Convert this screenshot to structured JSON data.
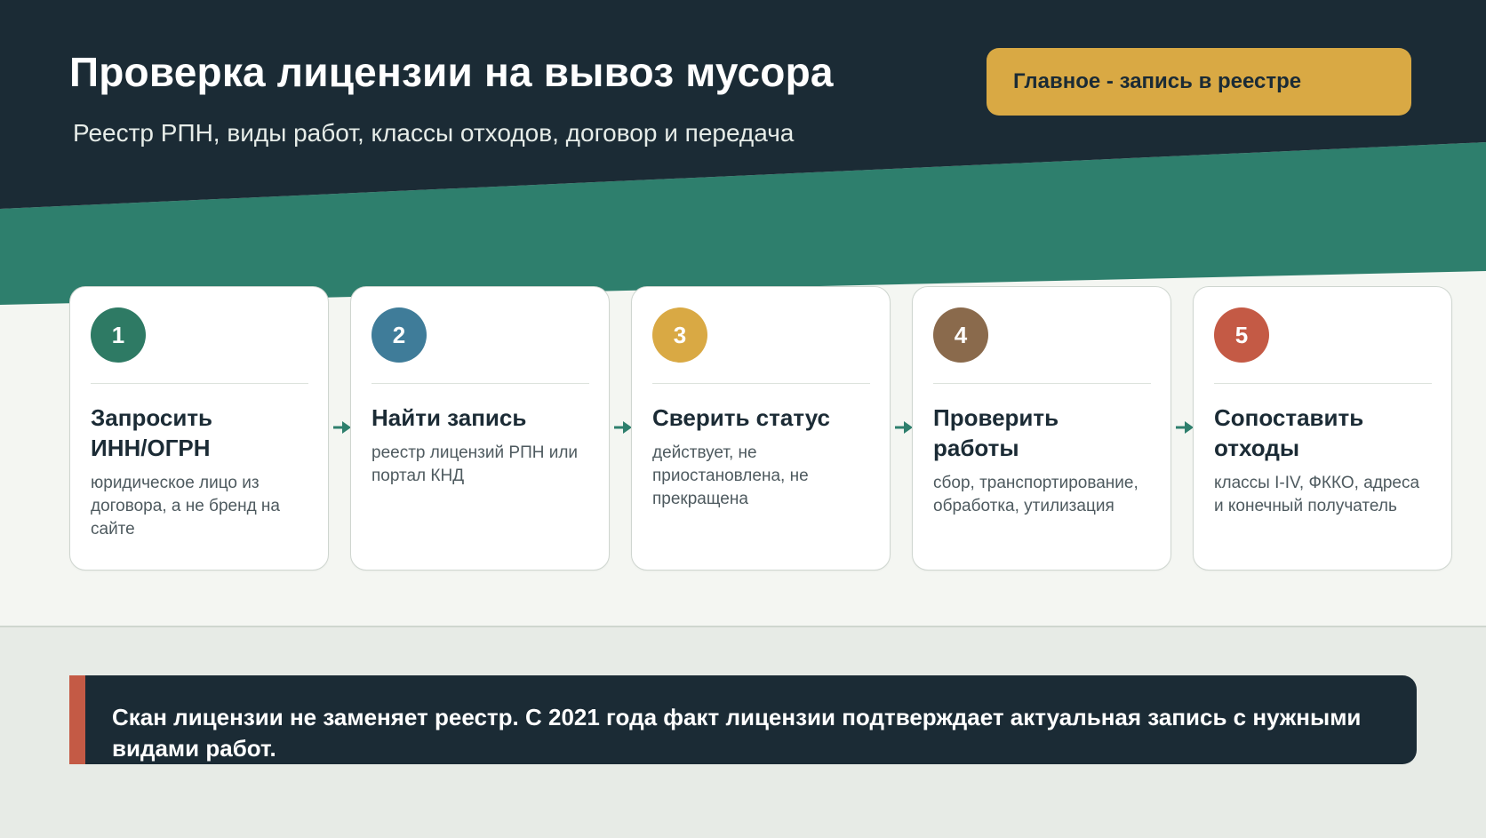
{
  "header": {
    "title": "Проверка лицензии на вывоз мусора",
    "subtitle": "Реестр РПН, виды работ, классы отходов, договор и передача",
    "key_badge": "Главное - запись в реестре"
  },
  "steps": [
    {
      "number": "1",
      "title": "Запросить ИНН/ОГРН",
      "description": "юридическое лицо из договора, а не бренд на сайте",
      "color": "#2e7a64"
    },
    {
      "number": "2",
      "title": "Найти запись",
      "description": "реестр лицензий РПН или портал КНД",
      "color": "#3f7c99"
    },
    {
      "number": "3",
      "title": "Сверить статус",
      "description": "действует, не приостановлена, не прекращена",
      "color": "#d9a944"
    },
    {
      "number": "4",
      "title": "Проверить работы",
      "description": "сбор, транспортирование, обработка, утилизация",
      "color": "#8a6a4c"
    },
    {
      "number": "5",
      "title": "Сопоставить отходы",
      "description": "классы I-IV, ФККО, адреса и конечный получатель",
      "color": "#c45a45"
    }
  ],
  "note": {
    "text": "Скан лицензии не заменяет реестр. С 2021 года факт лицензии подтверждает актуальная запись с нужными видами работ."
  },
  "colors": {
    "header_dark": "#1b2b35",
    "band_teal": "#2e7f6d",
    "accent_gold": "#d9a944",
    "accent_red": "#c45a45",
    "arrow": "#2e7f6d"
  }
}
